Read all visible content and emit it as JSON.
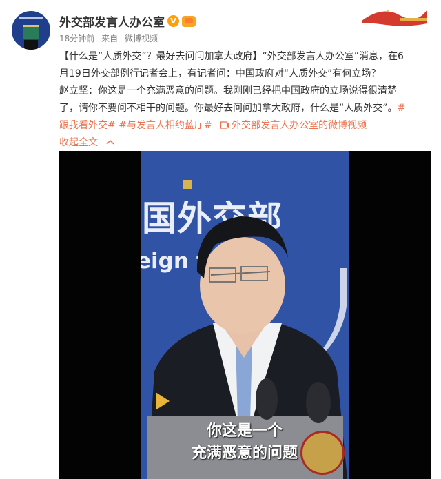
{
  "header": {
    "account_name": "外交部发言人办公室",
    "time": "18分钟前",
    "source_prefix": "来自",
    "source": "微博视频"
  },
  "post": {
    "line1_bracket_title": "【什么是“人质外交”？最好去问问加拿大政府】",
    "line1_rest": "“外交部发言人办公室”消息，在6",
    "line2": "月19日外交部例行记者会上，有记者问：中国政府对“人质外交”有何立场？",
    "line3": "赵立坚：你这是一个充满恶意的问题。我刚刚已经把中国政府的立场说得很清楚",
    "line4_text": "了，请你不要问不相干的问题。你最好去问问加拿大政府，什么是“人质外交”。",
    "line4_hash_start": "#",
    "hashtag1": "跟我看外交#",
    "hashtag2": "#与发言人相约蓝厅#",
    "video_link_icon": "video-link-icon",
    "video_link": "外交部发言人办公室的微博视频",
    "collapse": "收起全文",
    "collapse_icon": "chevron-up-icon"
  },
  "video": {
    "backdrop_cn": "国外交部",
    "backdrop_en": "eign  fairs",
    "caption_line1": "你这是一个",
    "caption_line2": "充满恶意的问题"
  },
  "colors": {
    "accent": "#eb7350",
    "backdrop": "#3053a6"
  }
}
